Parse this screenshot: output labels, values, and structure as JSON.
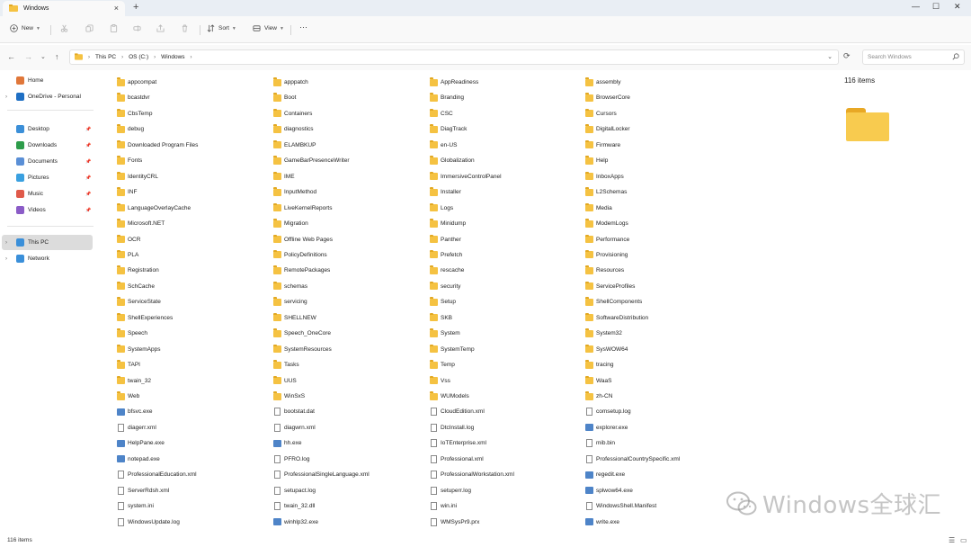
{
  "window": {
    "tab_title": "Windows",
    "controls": {
      "minimize": "—",
      "maximize": "☐",
      "close": "✕"
    }
  },
  "toolbar": {
    "new_label": "New",
    "sort_label": "Sort",
    "view_label": "View",
    "more_label": "···"
  },
  "address": {
    "crumbs": [
      "This PC",
      "OS (C:)",
      "Windows"
    ]
  },
  "search": {
    "placeholder": "Search Windows"
  },
  "sidebar": {
    "items": [
      {
        "label": "Home",
        "icon": "home-icon",
        "color": "#e0773a"
      },
      {
        "label": "OneDrive - Personal",
        "icon": "cloud-icon",
        "color": "#1f6fc4"
      },
      {
        "label": "Desktop",
        "icon": "desktop-icon",
        "color": "#3b8fd8"
      },
      {
        "label": "Downloads",
        "icon": "download-icon",
        "color": "#2d9c4a"
      },
      {
        "label": "Documents",
        "icon": "document-icon",
        "color": "#5a8fd6"
      },
      {
        "label": "Pictures",
        "icon": "picture-icon",
        "color": "#3aa0e0"
      },
      {
        "label": "Music",
        "icon": "music-icon",
        "color": "#e05a4a"
      },
      {
        "label": "Videos",
        "icon": "video-icon",
        "color": "#8b5cc7"
      },
      {
        "label": "This PC",
        "icon": "computer-icon",
        "color": "#3a8fd9"
      },
      {
        "label": "Network",
        "icon": "network-icon",
        "color": "#3a8fd9"
      }
    ]
  },
  "files": [
    [
      "appcompat",
      "apppatch",
      "AppReadiness",
      "assembly"
    ],
    [
      "bcastdvr",
      "Boot",
      "Branding",
      "BrowserCore"
    ],
    [
      "CbsTemp",
      "Containers",
      "CSC",
      "Cursors"
    ],
    [
      "debug",
      "diagnostics",
      "DiagTrack",
      "DigitalLocker"
    ],
    [
      "Downloaded Program Files",
      "ELAMBKUP",
      "en-US",
      "Firmware"
    ],
    [
      "Fonts",
      "GameBarPresenceWriter",
      "Globalization",
      "Help"
    ],
    [
      "IdentityCRL",
      "IME",
      "ImmersiveControlPanel",
      "InboxApps"
    ],
    [
      "INF",
      "InputMethod",
      "Installer",
      "L2Schemas"
    ],
    [
      "LanguageOverlayCache",
      "LiveKernelReports",
      "Logs",
      "Media"
    ],
    [
      "Microsoft.NET",
      "Migration",
      "Minidump",
      "ModemLogs"
    ],
    [
      "OCR",
      "Offline Web Pages",
      "Panther",
      "Performance"
    ],
    [
      "PLA",
      "PolicyDefinitions",
      "Prefetch",
      "Provisioning"
    ],
    [
      "Registration",
      "RemotePackages",
      "rescache",
      "Resources"
    ],
    [
      "SchCache",
      "schemas",
      "security",
      "ServiceProfiles"
    ],
    [
      "ServiceState",
      "servicing",
      "Setup",
      "ShellComponents"
    ],
    [
      "ShellExperiences",
      "SHELLNEW",
      "SKB",
      "SoftwareDistribution"
    ],
    [
      "Speech",
      "Speech_OneCore",
      "System",
      "System32"
    ],
    [
      "SystemApps",
      "SystemResources",
      "SystemTemp",
      "SysWOW64"
    ],
    [
      "TAPI",
      "Tasks",
      "Temp",
      "tracing"
    ],
    [
      "twain_32",
      "UUS",
      "Vss",
      "WaaS"
    ],
    [
      "Web",
      "WinSxS",
      "WUModels",
      "zh-CN"
    ],
    [
      "bfsvc.exe",
      "bootstat.dat",
      "CloudEdition.xml",
      "comsetup.log"
    ],
    [
      "diagerr.xml",
      "diagwrn.xml",
      "DtcInstall.log",
      "explorer.exe"
    ],
    [
      "HelpPane.exe",
      "hh.exe",
      "IoTEnterprise.xml",
      "mib.bin"
    ],
    [
      "notepad.exe",
      "PFRO.log",
      "Professional.xml",
      "ProfessionalCountrySpecific.xml"
    ],
    [
      "ProfessionalEducation.xml",
      "ProfessionalSingleLanguage.xml",
      "ProfessionalWorkstation.xml",
      "regedit.exe"
    ],
    [
      "ServerRdsh.xml",
      "setupact.log",
      "setuperr.log",
      "splwow64.exe"
    ],
    [
      "system.ini",
      "twain_32.dll",
      "win.ini",
      "WindowsShell.Manifest"
    ],
    [
      "WindowsUpdate.log",
      "winhlp32.exe",
      "WMSysPr9.prx",
      "write.exe"
    ]
  ],
  "details": {
    "item_count": "116 items"
  },
  "status": {
    "item_count": "116 items"
  },
  "watermark": {
    "text": "Windows全球汇"
  }
}
